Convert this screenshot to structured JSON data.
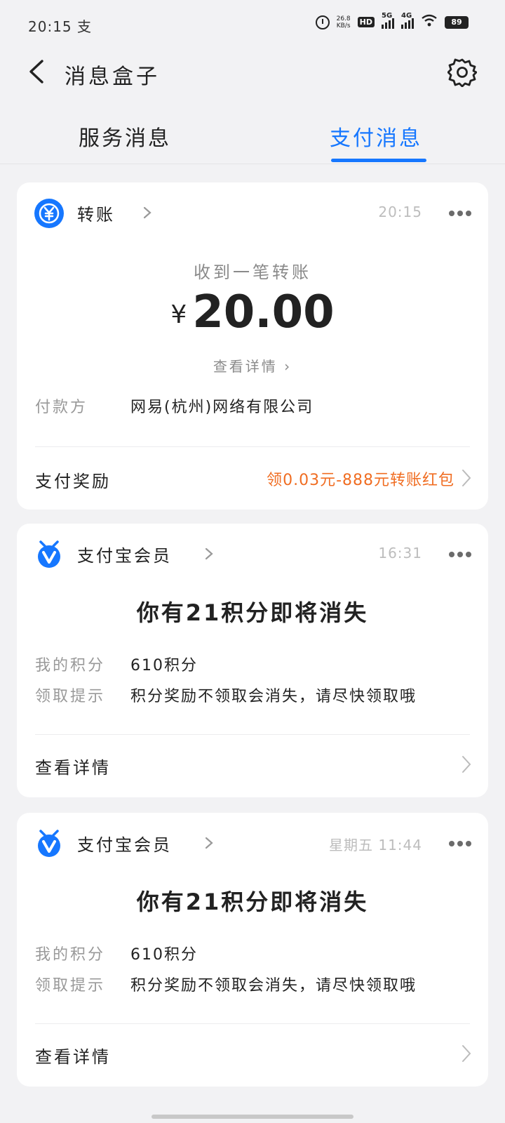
{
  "status": {
    "time": "20:15",
    "extra_glyph": "支",
    "net_speed": "26.8",
    "net_speed_unit": "KB/s",
    "hd": "HD",
    "sig1": "5G",
    "sig2": "4G",
    "battery": "89"
  },
  "nav": {
    "title": "消息盒子"
  },
  "tabs": [
    {
      "label": "服务消息",
      "active": false
    },
    {
      "label": "支付消息",
      "active": true
    }
  ],
  "colors": {
    "accent": "#1677ff",
    "promo": "#f06d22"
  },
  "transfer_card": {
    "app": "转账",
    "icon": "yuan-transfer-icon",
    "time": "20:15",
    "subtitle": "收到一笔转账",
    "currency": "¥",
    "amount": "20.00",
    "view_detail": "查看详情",
    "payer_label": "付款方",
    "payer": "网易(杭州)网络有限公司",
    "reward_label": "支付奖励",
    "reward_value": "领0.03元-888元转账红包"
  },
  "member_cards": [
    {
      "app": "支付宝会员",
      "icon": "member-badge-icon",
      "time": "16:31",
      "title": "你有21积分即将消失",
      "points_label": "我的积分",
      "points_value": "610积分",
      "tip_label": "领取提示",
      "tip_value": "积分奖励不领取会消失，请尽快领取哦",
      "footer": "查看详情"
    },
    {
      "app": "支付宝会员",
      "icon": "member-badge-icon",
      "time": "星期五 11:44",
      "title": "你有21积分即将消失",
      "points_label": "我的积分",
      "points_value": "610积分",
      "tip_label": "领取提示",
      "tip_value": "积分奖励不领取会消失，请尽快领取哦",
      "footer": "查看详情"
    }
  ]
}
